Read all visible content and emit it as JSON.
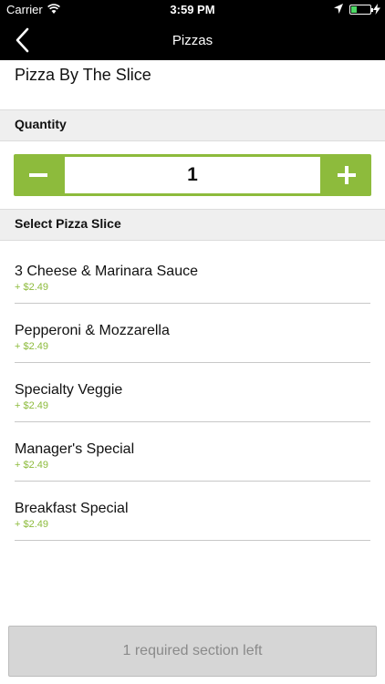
{
  "status_bar": {
    "carrier": "Carrier",
    "time": "3:59 PM",
    "battery_level": 0.3,
    "icons": [
      "wifi-icon",
      "location-arrow-icon",
      "battery-icon",
      "charging-bolt-icon"
    ]
  },
  "nav": {
    "title": "Pizzas",
    "back_icon": "chevron-left-icon"
  },
  "product": {
    "title": "Pizza By The Slice"
  },
  "quantity": {
    "header": "Quantity",
    "value": "1",
    "decrement_icon": "minus-icon",
    "increment_icon": "plus-icon"
  },
  "slice_section": {
    "header": "Select Pizza Slice",
    "options": [
      {
        "name": "3 Cheese & Marinara Sauce",
        "price": "+ $2.49"
      },
      {
        "name": "Pepperoni & Mozzarella",
        "price": "+ $2.49"
      },
      {
        "name": "Specialty Veggie",
        "price": "+ $2.49"
      },
      {
        "name": "Manager's Special",
        "price": "+ $2.49"
      },
      {
        "name": "Breakfast Special",
        "price": "+ $2.49"
      }
    ]
  },
  "footer": {
    "button_label": "1 required section left"
  },
  "colors": {
    "accent": "#8dbb3c",
    "nav_background": "#000000",
    "section_background": "#efefef",
    "disabled_button": "#d6d6d6"
  }
}
